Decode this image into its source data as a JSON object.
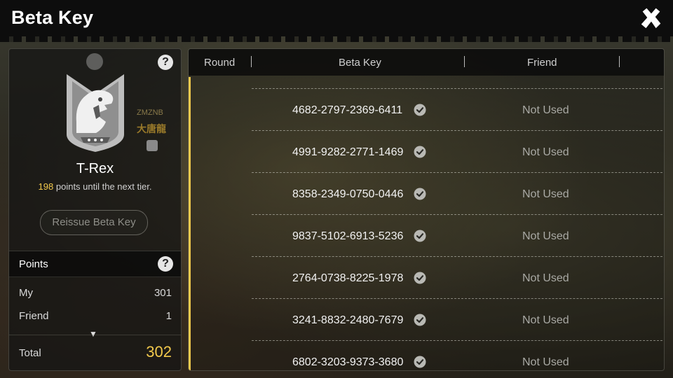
{
  "header": {
    "title": "Beta Key"
  },
  "profile": {
    "tier_name": "T-Rex",
    "points_until": "198",
    "points_until_suffix": " points until the next tier.",
    "side_text_small": "ZMZNB",
    "side_text_big": "大唐龍",
    "reissue_label": "Reissue Beta Key"
  },
  "points": {
    "header": "Points",
    "rows": [
      {
        "label": "My",
        "value": "301"
      },
      {
        "label": "Friend",
        "value": "1"
      }
    ],
    "total_label": "Total",
    "total_value": "302"
  },
  "table": {
    "columns": [
      "Round",
      "Beta Key",
      "Friend"
    ],
    "rows": [
      {
        "key": "4682-2797-2369-6411",
        "status": "Not Used"
      },
      {
        "key": "4991-9282-2771-1469",
        "status": "Not Used"
      },
      {
        "key": "8358-2349-0750-0446",
        "status": "Not Used"
      },
      {
        "key": "9837-5102-6913-5236",
        "status": "Not Used"
      },
      {
        "key": "2764-0738-8225-1978",
        "status": "Not Used"
      },
      {
        "key": "3241-8832-2480-7679",
        "status": "Not Used"
      },
      {
        "key": "6802-3203-9373-3680",
        "status": "Not Used"
      }
    ]
  },
  "colors": {
    "accent": "#f2c94c",
    "panel": "#161614"
  },
  "icons": {
    "close": "close-x-icon",
    "help": "help-icon",
    "verified": "check-circle-icon",
    "badge": "t-rex-badge-icon"
  }
}
